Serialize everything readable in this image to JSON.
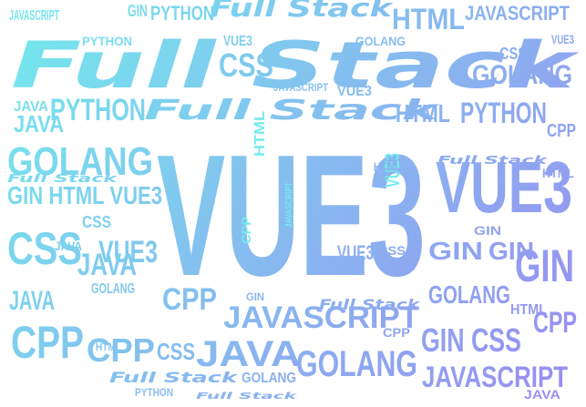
{
  "word_cloud": {
    "gradient": {
      "start": "#72ecec",
      "end": "#9a8af2"
    },
    "words": [
      {
        "text": "VUE3",
        "weight": 1.0
      },
      {
        "text": "Full Stack",
        "weight": 0.8
      },
      {
        "text": "Full Stack",
        "weight": 0.55
      },
      {
        "text": "VUE3",
        "weight": 0.55
      },
      {
        "text": "JAVASCRIPT",
        "weight": 0.45
      },
      {
        "text": "JAVASCRIPT",
        "weight": 0.4
      },
      {
        "text": "JAVA",
        "weight": 0.4
      },
      {
        "text": "GOLANG",
        "weight": 0.4
      },
      {
        "text": "GOLANG",
        "weight": 0.35
      },
      {
        "text": "CPP",
        "weight": 0.35
      },
      {
        "text": "CPP",
        "weight": 0.3
      },
      {
        "text": "CSS",
        "weight": 0.3
      },
      {
        "text": "GIN",
        "weight": 0.3
      },
      {
        "text": "PYTHON",
        "weight": 0.3
      },
      {
        "text": "HTML",
        "weight": 0.28
      },
      {
        "text": "GIN CSS",
        "weight": 0.28
      },
      {
        "text": "Full Stack",
        "weight": 0.2
      },
      {
        "text": "GOLANG",
        "weight": 0.2
      },
      {
        "text": "PYTHON",
        "weight": 0.2
      },
      {
        "text": "HTML",
        "weight": 0.2
      },
      {
        "text": "JAVASCRIPT",
        "weight": 0.2
      },
      {
        "text": "GIN",
        "weight": 0.2
      },
      {
        "text": "CSS",
        "weight": 0.2
      },
      {
        "text": "JAVA",
        "weight": 0.2
      },
      {
        "text": "VUE3",
        "weight": 0.2
      },
      {
        "text": "CPP",
        "weight": 0.2
      },
      {
        "text": "GIN HTML VUE3",
        "weight": 0.2
      },
      {
        "text": "GIN",
        "weight": 0.18
      },
      {
        "text": "JAVA",
        "weight": 0.18
      },
      {
        "text": "CPP",
        "weight": 0.18
      },
      {
        "text": "GOLANG",
        "weight": 0.15
      },
      {
        "text": "JAVA",
        "weight": 0.15
      },
      {
        "text": "PYTHON",
        "weight": 0.15
      },
      {
        "text": "HTML",
        "weight": 0.15
      },
      {
        "text": "Full Stack",
        "weight": 0.15
      },
      {
        "text": "Full Stack",
        "weight": 0.15
      },
      {
        "text": "VUE3",
        "weight": 0.15
      },
      {
        "text": "CSS",
        "weight": 0.12
      },
      {
        "text": "VUE3",
        "weight": 0.12
      },
      {
        "text": "JAVASCRIPT",
        "weight": 0.12
      },
      {
        "text": "HTML",
        "weight": 0.12
      },
      {
        "text": "GOLANG",
        "weight": 0.12
      },
      {
        "text": "CPP",
        "weight": 0.12
      },
      {
        "text": "Full Stack",
        "weight": 0.1
      },
      {
        "text": "GIN",
        "weight": 0.1
      },
      {
        "text": "CSS",
        "weight": 0.1
      },
      {
        "text": "JAVA",
        "weight": 0.1
      },
      {
        "text": "PYTHON",
        "weight": 0.1
      },
      {
        "text": "VUE3",
        "weight": 0.1
      },
      {
        "text": "HTML",
        "weight": 0.08
      },
      {
        "text": "CPP",
        "weight": 0.08
      },
      {
        "text": "GOLANG",
        "weight": 0.08
      },
      {
        "text": "JAVASCRIPT",
        "weight": 0.08
      },
      {
        "text": "Full Stack",
        "weight": 0.08
      },
      {
        "text": "GIN",
        "weight": 0.08
      },
      {
        "text": "CSS",
        "weight": 0.07
      },
      {
        "text": "VUE3",
        "weight": 0.07
      },
      {
        "text": "JAVA",
        "weight": 0.07
      },
      {
        "text": "HTML",
        "weight": 0.06
      },
      {
        "text": "PYTHON",
        "weight": 0.06
      },
      {
        "text": "CPP",
        "weight": 0.06
      },
      {
        "text": "Full Stack",
        "weight": 0.06
      },
      {
        "text": "GOLANG",
        "weight": 0.06
      },
      {
        "text": "GIN",
        "weight": 0.05
      },
      {
        "text": "JAVASCRIPT",
        "weight": 0.05
      },
      {
        "text": "CSS",
        "weight": 0.05
      },
      {
        "text": "VUE3",
        "weight": 0.05
      },
      {
        "text": "JAVA",
        "weight": 0.05
      },
      {
        "text": "HTML",
        "weight": 0.05
      },
      {
        "text": "CPP",
        "weight": 0.05
      }
    ]
  }
}
